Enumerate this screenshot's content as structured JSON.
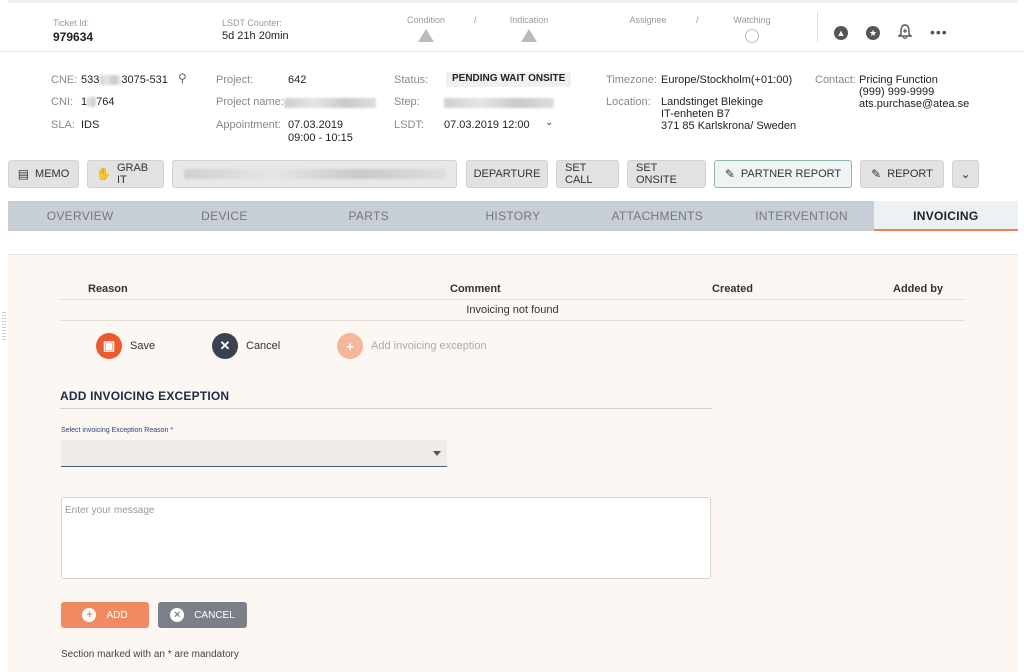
{
  "header": {
    "ticket_id_label": "Ticket Id:",
    "ticket_id": "979634",
    "lsdt_counter_label": "LSDT Counter:",
    "lsdt_counter": "5d 21h 20min",
    "condition_label": "Condition",
    "indication_label": "Indication",
    "assignee_label": "Assignee",
    "watching_label": "Watching",
    "separator": "/",
    "more": "•••"
  },
  "info": {
    "cne_label": "CNE:",
    "cne_prefix": "533",
    "cne_suffix": "3075-531",
    "cni_label": "CNI:",
    "cni_prefix": "1",
    "cni_suffix": "764",
    "sla_label": "SLA:",
    "sla_value": "IDS",
    "project_label": "Project:",
    "project_value": "642",
    "project_name_label": "Project name:",
    "appointment_label": "Appointment:",
    "appointment_date": "07.03.2019",
    "appointment_time": "09:00 - 10:15",
    "status_label": "Status:",
    "status_value": "PENDING WAIT ONSITE",
    "step_label": "Step:",
    "lsdt_label": "LSDT:",
    "lsdt_value": "07.03.2019 12:00",
    "timezone_label": "Timezone:",
    "timezone_value": "Europe/Stockholm(+01:00)",
    "location_label": "Location:",
    "location_line1": "Landstinget Blekinge",
    "location_line2": "IT-enheten B7",
    "location_line3": "371 85 Karlskrona/ Sweden",
    "contact_label": "Contact:",
    "contact_name": "Pricing Function",
    "contact_phone": "(999) 999-9999",
    "contact_email": "ats.purchase@atea.se"
  },
  "toolbar": {
    "memo": "MEMO",
    "grab_it": "GRAB IT",
    "departure": "DEPARTURE",
    "set_call": "SET CALL",
    "set_onsite": "SET ONSITE",
    "partner_report": "PARTNER REPORT",
    "report": "REPORT"
  },
  "tabs": [
    {
      "label": "OVERVIEW"
    },
    {
      "label": "DEVICE"
    },
    {
      "label": "PARTS"
    },
    {
      "label": "HISTORY"
    },
    {
      "label": "ATTACHMENTS"
    },
    {
      "label": "INTERVENTION"
    },
    {
      "label": "INVOICING"
    }
  ],
  "invoicing": {
    "columns": [
      "Reason",
      "Comment",
      "Created",
      "Added by"
    ],
    "empty_message": "Invoicing not found",
    "save": "Save",
    "cancel": "Cancel",
    "add_exception": "Add invoicing exception",
    "section_title": "ADD INVOICING EXCEPTION",
    "select_label": "Select invoicing Exception Reason *",
    "message_placeholder": "Enter your message",
    "add_button": "ADD",
    "cancel_button": "CANCEL",
    "mandatory_note": "Section marked with an * are mandatory"
  },
  "colors": {
    "accent": "#e85c2e",
    "active_tab_underline": "#e9864f",
    "tab_bar": "#c8ced6"
  }
}
